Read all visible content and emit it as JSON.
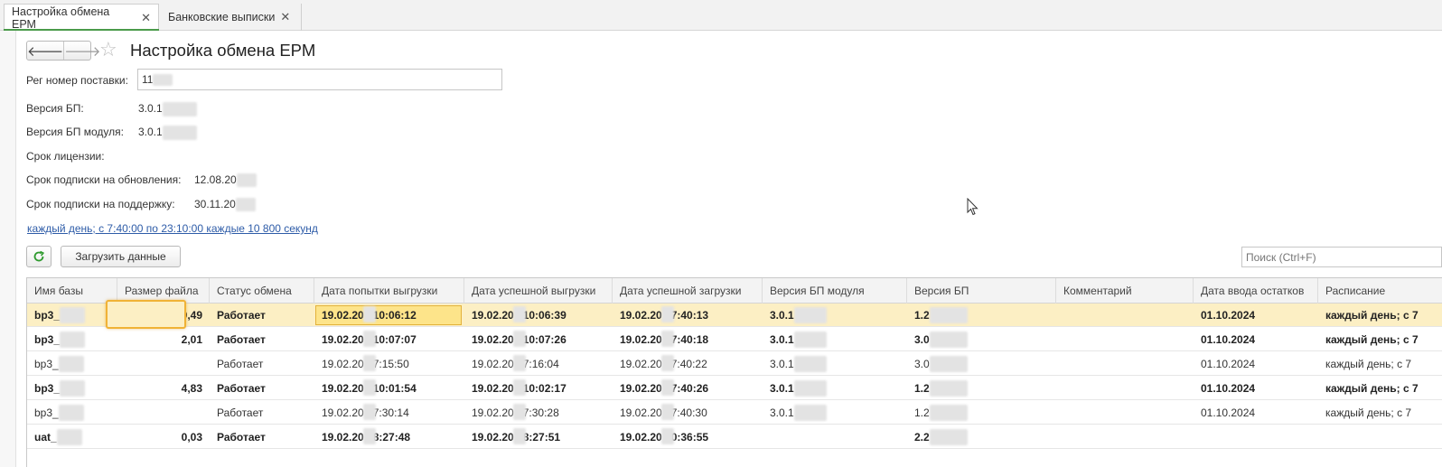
{
  "tabs": [
    {
      "label": "Настройка обмена ЕРМ",
      "active": true
    },
    {
      "label": "Банковские выписки",
      "active": false
    }
  ],
  "header": {
    "title": "Настройка обмена ЕРМ"
  },
  "info": {
    "reg_label": "Рег номер поставки:",
    "reg_value": "11",
    "bp_version_label": "Версия БП:",
    "bp_version_value": "3.0.1",
    "bp_module_label": "Версия БП модуля:",
    "bp_module_value": "3.0.1",
    "license_label": "Срок лицензии:",
    "updates_label": "Срок подписки на обновления:",
    "updates_value": "12.08.20",
    "support_label": "Срок подписки на поддержку:",
    "support_value": "30.11.20"
  },
  "schedule_link": "каждый день; с 7:40:00 по 23:10:00 каждые 10 800 секунд",
  "toolbar": {
    "load_label": "Загрузить данные",
    "search_placeholder": "Поиск (Ctrl+F)"
  },
  "table": {
    "columns": [
      "Имя базы",
      "Размер файла",
      "Статус обмена",
      "Дата попытки выгрузки",
      "Дата успешной выгрузки",
      "Дата успешной загрузки",
      "Версия БП модуля",
      "Версия БП",
      "Комментарий",
      "Дата ввода остатков",
      "Расписание"
    ],
    "rows": [
      {
        "bold": true,
        "selected": true,
        "cells": [
          "bp3_",
          "9,49",
          "Работает",
          "19.02.20   10:06:12",
          "19.02.20   10:06:39",
          "19.02.20   7:40:13",
          "3.0.1",
          "1.2",
          "",
          "01.10.2024",
          "каждый день; с 7"
        ]
      },
      {
        "bold": true,
        "selected": false,
        "cells": [
          "bp3_",
          "2,01",
          "Работает",
          "19.02.20   10:07:07",
          "19.02.20   10:07:26",
          "19.02.20   7:40:18",
          "3.0.1",
          "3.0",
          "",
          "01.10.2024",
          "каждый день; с 7"
        ]
      },
      {
        "bold": false,
        "selected": false,
        "cells": [
          "bp3_",
          "",
          "Работает",
          "19.02.20   7:15:50",
          "19.02.20   7:16:04",
          "19.02.20   7:40:22",
          "3.0.1",
          "3.0",
          "",
          "01.10.2024",
          "каждый день; с 7"
        ]
      },
      {
        "bold": true,
        "selected": false,
        "cells": [
          "bp3_",
          "4,83",
          "Работает",
          "19.02.20   10:01:54",
          "19.02.20   10:02:17",
          "19.02.20   7:40:26",
          "3.0.1",
          "1.2",
          "",
          "01.10.2024",
          "каждый день; с 7"
        ]
      },
      {
        "bold": false,
        "selected": false,
        "cells": [
          "bp3_",
          "",
          "Работает",
          "19.02.20   7:30:14",
          "19.02.20   7:30:28",
          "19.02.20   7:40:30",
          "3.0.1",
          "1.2",
          "",
          "01.10.2024",
          "каждый день; с 7"
        ]
      },
      {
        "bold": true,
        "selected": false,
        "cells": [
          "uat_",
          "0,03",
          "Работает",
          "19.02.20   8:27:48",
          "19.02.20   8:27:51",
          "19.02.20   0:36:55",
          "",
          "2.2",
          "",
          "",
          ""
        ]
      }
    ]
  },
  "colors": {
    "selected_row": "#fcefc4",
    "active_tab_underline": "#4a9a4a",
    "link": "#2e5ca8"
  }
}
